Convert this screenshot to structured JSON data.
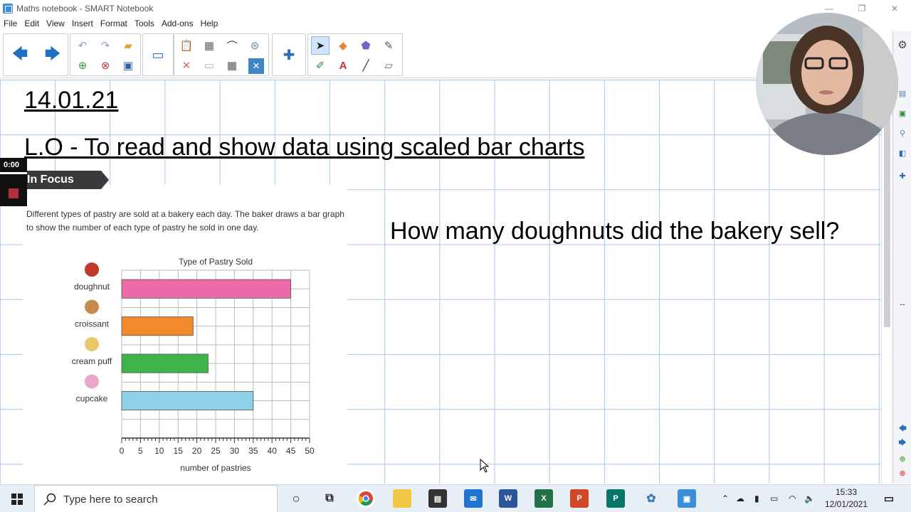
{
  "window": {
    "title": "Maths notebook - SMART Notebook",
    "controls": [
      "—",
      "❐",
      "✕"
    ]
  },
  "menu": [
    "File",
    "Edit",
    "View",
    "Insert",
    "Format",
    "Tools",
    "Add-ons",
    "Help"
  ],
  "page": {
    "date": "14.01.21",
    "learning_objective": "L.O - To read and show data using scaled bar charts",
    "question": "How many doughnuts did the bakery sell?"
  },
  "worksheet": {
    "section_label": "In Focus",
    "intro_text": "Different types of pastry are sold at a bakery each day. The baker draws a bar graph to show the number of each type of pastry he sold in one day."
  },
  "chart_data": {
    "type": "bar",
    "orientation": "horizontal",
    "title": "Type of Pastry Sold",
    "categories": [
      "doughnut",
      "croissant",
      "cream puff",
      "cupcake"
    ],
    "values": [
      45,
      19,
      23,
      35
    ],
    "colors": [
      "#ea6ba8",
      "#f08a2a",
      "#3fb34a",
      "#8fd0e6"
    ],
    "xlabel": "number of pastries",
    "ylabel": "",
    "xlim": [
      0,
      50
    ],
    "xticks": [
      "0",
      "5",
      "10",
      "15",
      "20",
      "25",
      "30",
      "35",
      "40",
      "45",
      "50"
    ],
    "grid": true
  },
  "timer": {
    "time": "0:00"
  },
  "taskbar": {
    "search_placeholder": "Type here to search",
    "time": "15:33",
    "date": "12/01/2021"
  }
}
